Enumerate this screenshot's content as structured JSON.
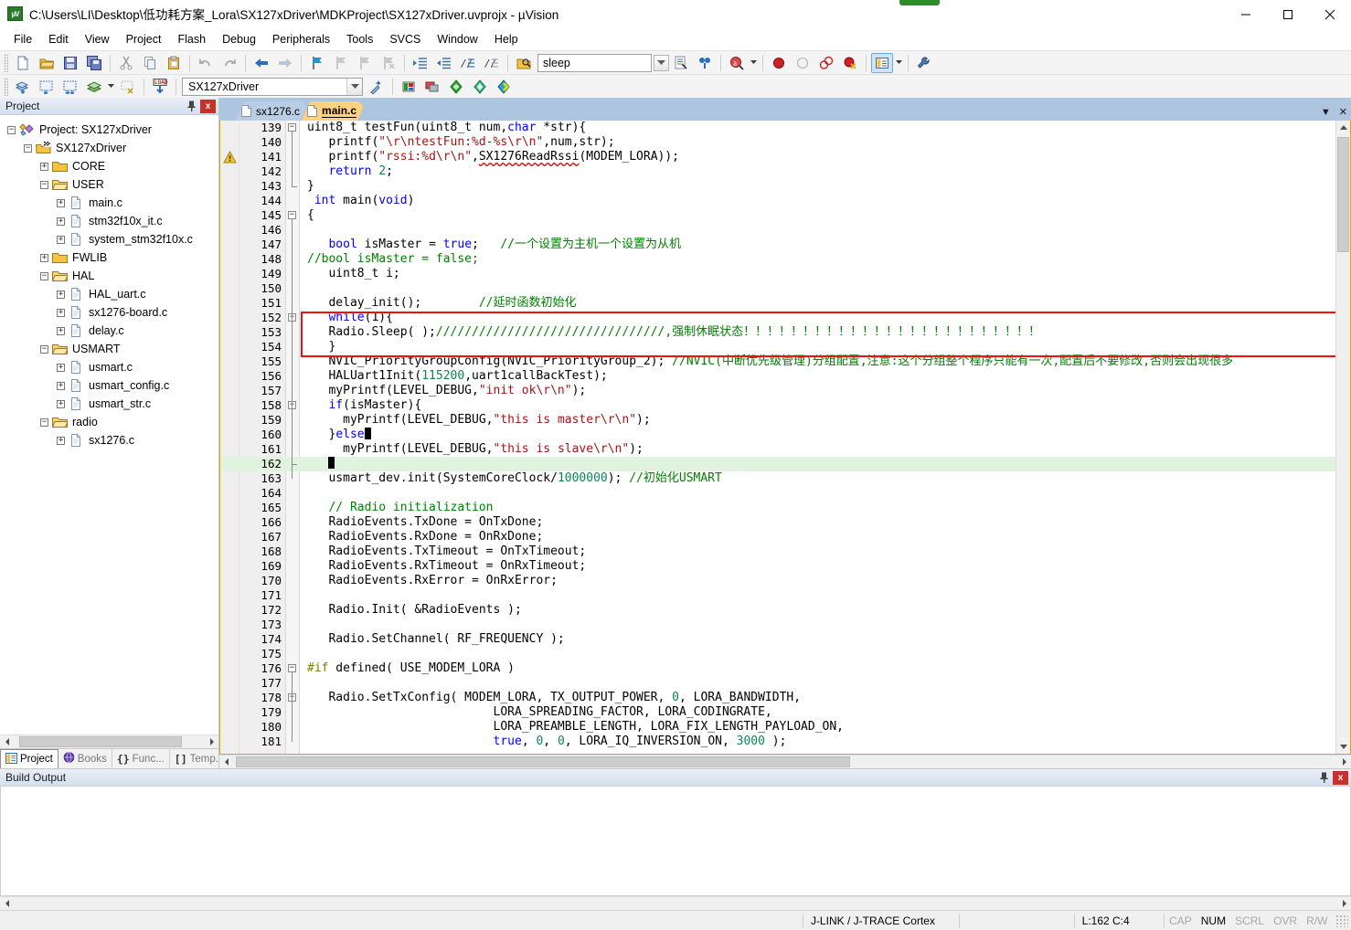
{
  "window": {
    "title": "C:\\Users\\LI\\Desktop\\低功耗方案_Lora\\SX127xDriver\\MDKProject\\SX127xDriver.uvprojx - µVision",
    "app_icon": "uvision-icon",
    "minimize_label": "Minimize",
    "maximize_label": "Maximize",
    "close_label": "Close"
  },
  "menubar": {
    "items": [
      {
        "label": "File"
      },
      {
        "label": "Edit"
      },
      {
        "label": "View"
      },
      {
        "label": "Project"
      },
      {
        "label": "Flash"
      },
      {
        "label": "Debug"
      },
      {
        "label": "Peripherals"
      },
      {
        "label": "Tools"
      },
      {
        "label": "SVCS"
      },
      {
        "label": "Window"
      },
      {
        "label": "Help"
      }
    ]
  },
  "toolbar_main": {
    "buttons": [
      {
        "name": "new-file-icon",
        "glyph": "□"
      },
      {
        "name": "open-file-icon",
        "glyph": "□"
      },
      {
        "name": "save-icon",
        "glyph": "□"
      },
      {
        "name": "save-all-icon",
        "glyph": "□"
      },
      {
        "name": "cut-icon",
        "glyph": "✂"
      },
      {
        "name": "copy-icon",
        "glyph": "⎘"
      },
      {
        "name": "paste-icon",
        "glyph": "▤"
      },
      {
        "name": "undo-icon",
        "glyph": "↶"
      },
      {
        "name": "redo-icon",
        "glyph": "↷"
      },
      {
        "name": "navigate-back-icon",
        "glyph": "←"
      },
      {
        "name": "navigate-forward-icon",
        "glyph": "→"
      },
      {
        "name": "bookmark-toggle-icon",
        "glyph": "⚑"
      },
      {
        "name": "bookmark-prev-icon",
        "glyph": "⚑"
      },
      {
        "name": "bookmark-next-icon",
        "glyph": "⚑"
      },
      {
        "name": "bookmark-clear-icon",
        "glyph": "⚑"
      },
      {
        "name": "indent-increase-icon",
        "glyph": "→|"
      },
      {
        "name": "indent-decrease-icon",
        "glyph": "|←"
      },
      {
        "name": "comment-lines-icon",
        "glyph": "//"
      },
      {
        "name": "uncomment-lines-icon",
        "glyph": "//"
      }
    ],
    "search": {
      "find-in-files-icon": "binoculars-icon",
      "value": "sleep",
      "placeholder": ""
    },
    "after_search": [
      {
        "name": "find-in-files-icon"
      },
      {
        "name": "incremental-find-icon"
      },
      {
        "name": "browse-symbol-icon"
      },
      {
        "name": "start-debug-icon"
      },
      {
        "name": "insert-breakpoint-icon"
      },
      {
        "name": "disable-breakpoint-icon"
      },
      {
        "name": "kill-all-breakpoints-icon"
      },
      {
        "name": "project-window-icon"
      },
      {
        "name": "configure-icon"
      }
    ]
  },
  "toolbar_build": {
    "buttons": [
      {
        "name": "translate-icon"
      },
      {
        "name": "build-icon"
      },
      {
        "name": "rebuild-icon"
      },
      {
        "name": "batch-build-icon"
      },
      {
        "name": "stop-build-icon"
      },
      {
        "name": "download-icon"
      }
    ],
    "target_select": {
      "value": "SX127xDriver",
      "name": "target-select"
    },
    "right_buttons": [
      {
        "name": "target-options-icon"
      },
      {
        "name": "manage-project-items-icon"
      },
      {
        "name": "manage-runtime-env-icon"
      },
      {
        "name": "pack-installer-icon"
      },
      {
        "name": "multi-project-icon"
      }
    ]
  },
  "project_pane": {
    "title": "Project",
    "pin_icon": "pin-icon",
    "close_icon": "close-icon",
    "tree": [
      {
        "indent": 0,
        "expander": "-",
        "icon": "project-icon",
        "label": "Project: SX127xDriver"
      },
      {
        "indent": 1,
        "expander": "-",
        "icon": "target-icon",
        "label": "SX127xDriver"
      },
      {
        "indent": 2,
        "expander": "+",
        "icon": "folder-closed-icon",
        "label": "CORE"
      },
      {
        "indent": 2,
        "expander": "-",
        "icon": "folder-open-icon",
        "label": "USER"
      },
      {
        "indent": 3,
        "expander": "+",
        "icon": "c-file-icon",
        "label": "main.c"
      },
      {
        "indent": 3,
        "expander": "+",
        "icon": "c-file-icon",
        "label": "stm32f10x_it.c"
      },
      {
        "indent": 3,
        "expander": "+",
        "icon": "c-file-icon",
        "label": "system_stm32f10x.c"
      },
      {
        "indent": 2,
        "expander": "+",
        "icon": "folder-closed-icon",
        "label": "FWLIB"
      },
      {
        "indent": 2,
        "expander": "-",
        "icon": "folder-open-icon",
        "label": "HAL"
      },
      {
        "indent": 3,
        "expander": "+",
        "icon": "c-file-icon",
        "label": "HAL_uart.c"
      },
      {
        "indent": 3,
        "expander": "+",
        "icon": "c-file-icon",
        "label": "sx1276-board.c"
      },
      {
        "indent": 3,
        "expander": "+",
        "icon": "c-file-icon",
        "label": "delay.c"
      },
      {
        "indent": 2,
        "expander": "-",
        "icon": "folder-open-icon",
        "label": "USMART"
      },
      {
        "indent": 3,
        "expander": "+",
        "icon": "c-file-icon",
        "label": "usmart.c"
      },
      {
        "indent": 3,
        "expander": "+",
        "icon": "c-file-icon",
        "label": "usmart_config.c"
      },
      {
        "indent": 3,
        "expander": "+",
        "icon": "c-file-icon",
        "label": "usmart_str.c"
      },
      {
        "indent": 2,
        "expander": "-",
        "icon": "folder-open-icon",
        "label": "radio"
      },
      {
        "indent": 3,
        "expander": "+",
        "icon": "c-file-icon",
        "label": "sx1276.c"
      }
    ],
    "tabs": [
      {
        "label": "Project",
        "icon": "project-tab-icon",
        "active": true
      },
      {
        "label": "Books",
        "icon": "books-tab-icon",
        "active": false
      },
      {
        "label": "Func...",
        "icon": "functions-tab-icon",
        "active": false
      },
      {
        "label": "Temp...",
        "icon": "templates-tab-icon",
        "active": false
      }
    ]
  },
  "editor": {
    "tabs": [
      {
        "label": "sx1276.c",
        "active": false
      },
      {
        "label": "main.c",
        "active": true
      }
    ],
    "tab_controls": [
      {
        "name": "tab-list-dropdown-icon",
        "glyph": "▼"
      },
      {
        "name": "close-tab-icon",
        "glyph": "✕"
      }
    ],
    "lines": [
      {
        "n": 139,
        "fold": "-",
        "segs": [
          {
            "t": "uint8_t testFun(uint8_t num,",
            "c": "plain"
          },
          {
            "t": "char",
            "c": "kw"
          },
          {
            "t": " *str){",
            "c": "plain"
          }
        ]
      },
      {
        "n": 140,
        "segs": [
          {
            "t": "   printf(",
            "c": "plain"
          },
          {
            "t": "\"\\r\\ntestFun:%d-%s\\r\\n\"",
            "c": "str"
          },
          {
            "t": ",num,str);",
            "c": "plain"
          }
        ]
      },
      {
        "n": 141,
        "warn": true,
        "segs": [
          {
            "t": "   printf(",
            "c": "plain"
          },
          {
            "t": "\"rssi:%d\\r\\n\"",
            "c": "str"
          },
          {
            "t": ",",
            "c": "plain"
          },
          {
            "t": "SX1276ReadRssi",
            "c": "sq"
          },
          {
            "t": "(MODEM_LORA));",
            "c": "plain"
          }
        ]
      },
      {
        "n": 142,
        "segs": [
          {
            "t": "   ",
            "c": "plain"
          },
          {
            "t": "return",
            "c": "kw"
          },
          {
            "t": " ",
            "c": "plain"
          },
          {
            "t": "2",
            "c": "num"
          },
          {
            "t": ";",
            "c": "plain"
          }
        ]
      },
      {
        "n": 143,
        "foldend": true,
        "segs": [
          {
            "t": "}",
            "c": "plain"
          }
        ]
      },
      {
        "n": 144,
        "segs": [
          {
            "t": " ",
            "c": "plain"
          },
          {
            "t": "int",
            "c": "kw"
          },
          {
            "t": " main(",
            "c": "plain"
          },
          {
            "t": "void",
            "c": "kw"
          },
          {
            "t": ")",
            "c": "plain"
          }
        ]
      },
      {
        "n": 145,
        "fold": "-",
        "segs": [
          {
            "t": "{",
            "c": "plain"
          }
        ]
      },
      {
        "n": 146,
        "segs": []
      },
      {
        "n": 147,
        "segs": [
          {
            "t": "   ",
            "c": "plain"
          },
          {
            "t": "bool",
            "c": "kw"
          },
          {
            "t": " isMaster = ",
            "c": "plain"
          },
          {
            "t": "true",
            "c": "kw"
          },
          {
            "t": ";   ",
            "c": "plain"
          },
          {
            "t": "//一个设置为主机一个设置为从机",
            "c": "cmt"
          }
        ]
      },
      {
        "n": 148,
        "segs": [
          {
            "t": "//bool isMaster = false;",
            "c": "cmt"
          }
        ]
      },
      {
        "n": 149,
        "segs": [
          {
            "t": "   uint8_t i;",
            "c": "plain"
          }
        ]
      },
      {
        "n": 150,
        "segs": []
      },
      {
        "n": 151,
        "segs": [
          {
            "t": "   delay_init();        ",
            "c": "plain"
          },
          {
            "t": "//延时函数初始化",
            "c": "cmt"
          }
        ]
      },
      {
        "n": 152,
        "fold": "-",
        "segs": [
          {
            "t": "   ",
            "c": "plain"
          },
          {
            "t": "while",
            "c": "kw"
          },
          {
            "t": "(1){",
            "c": "plain"
          }
        ]
      },
      {
        "n": 153,
        "segs": [
          {
            "t": "   Radio.Sleep( );",
            "c": "plain"
          },
          {
            "t": "////////////////////////////////,强制休眠状态！！！！！！！！！！！！！！！！！！！！！！！！！",
            "c": "cmt"
          }
        ]
      },
      {
        "n": 154,
        "segs": [
          {
            "t": "   }",
            "c": "plain"
          }
        ]
      },
      {
        "n": 155,
        "segs": [
          {
            "t": "   NVIC_PriorityGroupConfig(NVIC_PriorityGroup_2); ",
            "c": "plain"
          },
          {
            "t": "//NVIC(中断优先级管理)分组配置,注意:这个分组整个程序只能有一次,配置后不要修改,否则会出现很多",
            "c": "cmt"
          }
        ]
      },
      {
        "n": 156,
        "segs": [
          {
            "t": "   HALUart1Init(",
            "c": "plain"
          },
          {
            "t": "115200",
            "c": "num"
          },
          {
            "t": ",uart1callBackTest);",
            "c": "plain"
          }
        ]
      },
      {
        "n": 157,
        "segs": [
          {
            "t": "   myPrintf(LEVEL_DEBUG,",
            "c": "plain"
          },
          {
            "t": "\"init ok\\r\\n\"",
            "c": "str"
          },
          {
            "t": ");",
            "c": "plain"
          }
        ]
      },
      {
        "n": 158,
        "fold": "-",
        "segs": [
          {
            "t": "   ",
            "c": "plain"
          },
          {
            "t": "if",
            "c": "kw"
          },
          {
            "t": "(isMaster){",
            "c": "plain"
          }
        ]
      },
      {
        "n": 159,
        "segs": [
          {
            "t": "     myPrintf(LEVEL_DEBUG,",
            "c": "plain"
          },
          {
            "t": "\"this is master\\r\\n\"",
            "c": "str"
          },
          {
            "t": ");",
            "c": "plain"
          }
        ]
      },
      {
        "n": 160,
        "segs": [
          {
            "t": "   }",
            "c": "plain"
          },
          {
            "t": "else",
            "c": "kw"
          },
          {
            "t": "|CARET|",
            "c": "caret"
          }
        ]
      },
      {
        "n": 161,
        "segs": [
          {
            "t": "     myPrintf(LEVEL_DEBUG,",
            "c": "plain"
          },
          {
            "t": "\"this is slave\\r\\n\"",
            "c": "str"
          },
          {
            "t": ");",
            "c": "plain"
          }
        ]
      },
      {
        "n": 162,
        "highlight": true,
        "foldend": true,
        "segs": [
          {
            "t": "   ",
            "c": "plain"
          },
          {
            "t": "|CARET|",
            "c": "caret"
          }
        ]
      },
      {
        "n": 163,
        "segs": [
          {
            "t": "   usmart_dev.init(SystemCoreClock/",
            "c": "plain"
          },
          {
            "t": "1000000",
            "c": "num"
          },
          {
            "t": "); ",
            "c": "plain"
          },
          {
            "t": "//初始化USMART",
            "c": "cmt"
          }
        ]
      },
      {
        "n": 164,
        "segs": []
      },
      {
        "n": 165,
        "segs": [
          {
            "t": "   // Radio initialization",
            "c": "cmt"
          }
        ]
      },
      {
        "n": 166,
        "segs": [
          {
            "t": "   RadioEvents.TxDone = OnTxDone;",
            "c": "plain"
          }
        ]
      },
      {
        "n": 167,
        "segs": [
          {
            "t": "   RadioEvents.RxDone = OnRxDone;",
            "c": "plain"
          }
        ]
      },
      {
        "n": 168,
        "segs": [
          {
            "t": "   RadioEvents.TxTimeout = OnTxTimeout;",
            "c": "plain"
          }
        ]
      },
      {
        "n": 169,
        "segs": [
          {
            "t": "   RadioEvents.RxTimeout = OnRxTimeout;",
            "c": "plain"
          }
        ]
      },
      {
        "n": 170,
        "segs": [
          {
            "t": "   RadioEvents.RxError = OnRxError;",
            "c": "plain"
          }
        ]
      },
      {
        "n": 171,
        "segs": []
      },
      {
        "n": 172,
        "segs": [
          {
            "t": "   Radio.Init( &RadioEvents );",
            "c": "plain"
          }
        ]
      },
      {
        "n": 173,
        "segs": []
      },
      {
        "n": 174,
        "segs": [
          {
            "t": "   Radio.SetChannel( RF_FREQUENCY );",
            "c": "plain"
          }
        ]
      },
      {
        "n": 175,
        "segs": []
      },
      {
        "n": 176,
        "fold": "-",
        "segs": [
          {
            "t": "#if",
            "c": "pp"
          },
          {
            "t": " defined( USE_MODEM_LORA )",
            "c": "plain"
          }
        ]
      },
      {
        "n": 177,
        "segs": []
      },
      {
        "n": 178,
        "fold": "-",
        "segs": [
          {
            "t": "   Radio.SetTxConfig( MODEM_LORA, TX_OUTPUT_POWER, ",
            "c": "plain"
          },
          {
            "t": "0",
            "c": "num"
          },
          {
            "t": ", LORA_BANDWIDTH,",
            "c": "plain"
          }
        ]
      },
      {
        "n": 179,
        "segs": [
          {
            "t": "                          LORA_SPREADING_FACTOR, LORA_CODINGRATE,",
            "c": "plain"
          }
        ]
      },
      {
        "n": 180,
        "segs": [
          {
            "t": "                          LORA_PREAMBLE_LENGTH, LORA_FIX_LENGTH_PAYLOAD_ON,",
            "c": "plain"
          }
        ]
      },
      {
        "n": 181,
        "segs": [
          {
            "t": "                          ",
            "c": "plain"
          },
          {
            "t": "true",
            "c": "kw"
          },
          {
            "t": ", ",
            "c": "plain"
          },
          {
            "t": "0",
            "c": "num"
          },
          {
            "t": ", ",
            "c": "plain"
          },
          {
            "t": "0",
            "c": "num"
          },
          {
            "t": ", LORA_IQ_INVERSION_ON, ",
            "c": "plain"
          },
          {
            "t": "3000",
            "c": "num"
          },
          {
            "t": " );",
            "c": "plain"
          }
        ]
      }
    ],
    "annotation": {
      "name": "red-highlight-box",
      "color": "#ee1111"
    }
  },
  "build_output": {
    "title": "Build Output",
    "pin_icon": "pin-icon",
    "close_icon": "close-icon",
    "content": ""
  },
  "statusbar": {
    "debugger": "J-LINK / J-TRACE Cortex",
    "position": "L:162 C:4",
    "flags": [
      {
        "label": "CAP",
        "on": false
      },
      {
        "label": "NUM",
        "on": true
      },
      {
        "label": "SCRL",
        "on": false
      },
      {
        "label": "OVR",
        "on": false
      },
      {
        "label": "R/W",
        "on": false
      }
    ]
  },
  "colors": {
    "accent": "#ffd27f",
    "tabbar": "#aec5e0",
    "highlight_line": "#dff3df",
    "red_box": "#ee1111",
    "comment": "#008000",
    "string": "#a31515",
    "keyword": "#0000ff"
  }
}
